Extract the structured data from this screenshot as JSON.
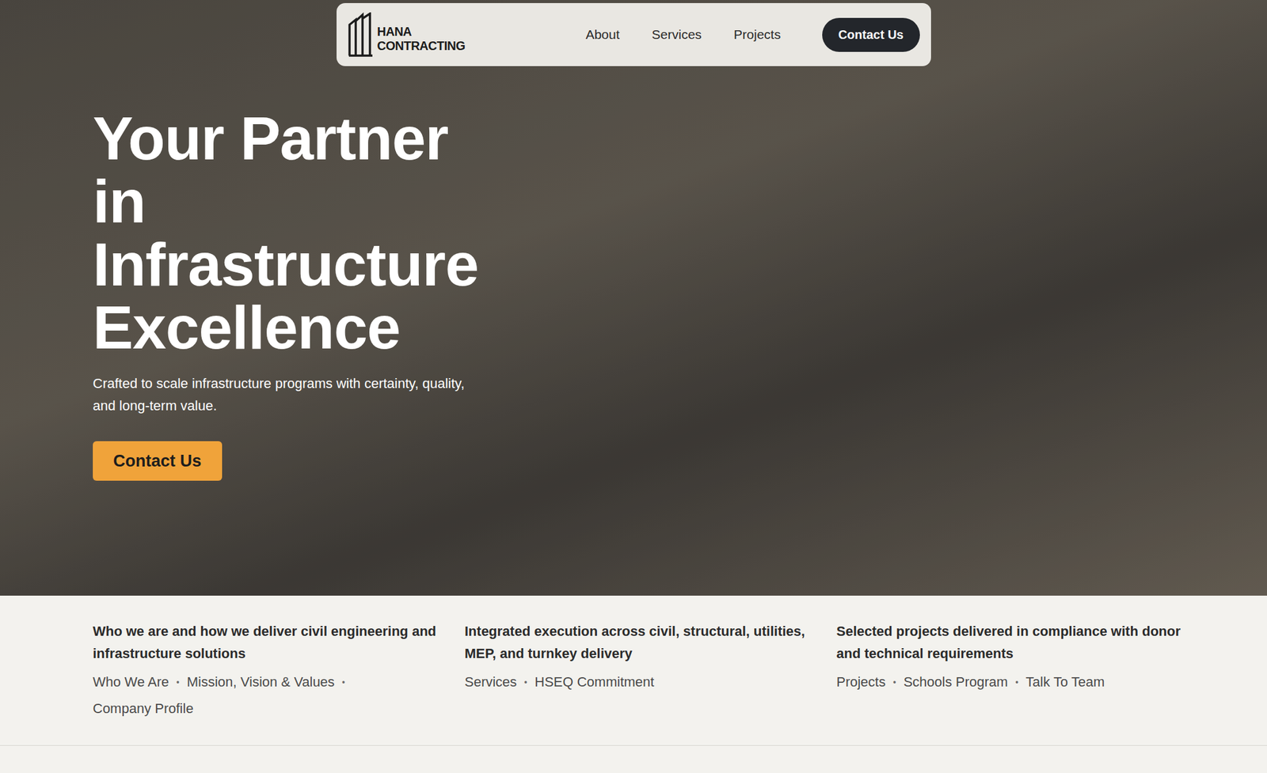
{
  "nav": {
    "logo": {
      "line1": "HANA",
      "line2": "CONTRACTING"
    },
    "links": [
      {
        "label": "About"
      },
      {
        "label": "Services"
      },
      {
        "label": "Projects"
      }
    ],
    "cta": "Contact Us"
  },
  "hero": {
    "title": "Your Partner in Infrastructure Excellence",
    "subtitle": "Crafted to scale infrastructure programs with certainty, quality, and long-term value.",
    "cta": "Contact Us"
  },
  "columns": [
    {
      "heading": "Who we are and how we deliver civil engineering and infrastructure solutions",
      "links": [
        "Who We Are",
        "Mission, Vision & Values",
        "Company Profile"
      ],
      "separator": "•"
    },
    {
      "heading": "Integrated execution across civil, structural, utilities, MEP, and turnkey delivery",
      "links": [
        "Services",
        "HSEQ Commitment"
      ],
      "separator": "•"
    },
    {
      "heading": "Selected projects delivered in compliance with donor and technical requirements",
      "links": [
        "Projects",
        "Schools Program",
        "Talk To Team"
      ],
      "separator": "•"
    }
  ]
}
